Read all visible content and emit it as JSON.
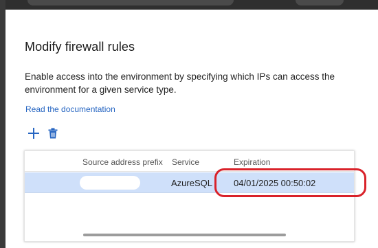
{
  "dialog": {
    "title": "Modify firewall rules",
    "description": "Enable access into the environment by specifying which IPs can access the environment for a given service type.",
    "doc_link": "Read the documentation"
  },
  "toolbar": {
    "add_icon": "plus-icon",
    "delete_icon": "trash-icon",
    "accent_color": "#2766c2"
  },
  "table": {
    "columns": [
      "Source address prefix",
      "Service",
      "Expiration"
    ],
    "rows": [
      {
        "source": "",
        "service": "AzureSQL",
        "expiration": "04/01/2025 00:50:02"
      }
    ],
    "selected_row_color": "#cfe0fa",
    "annotation_color": "#d9222a"
  }
}
